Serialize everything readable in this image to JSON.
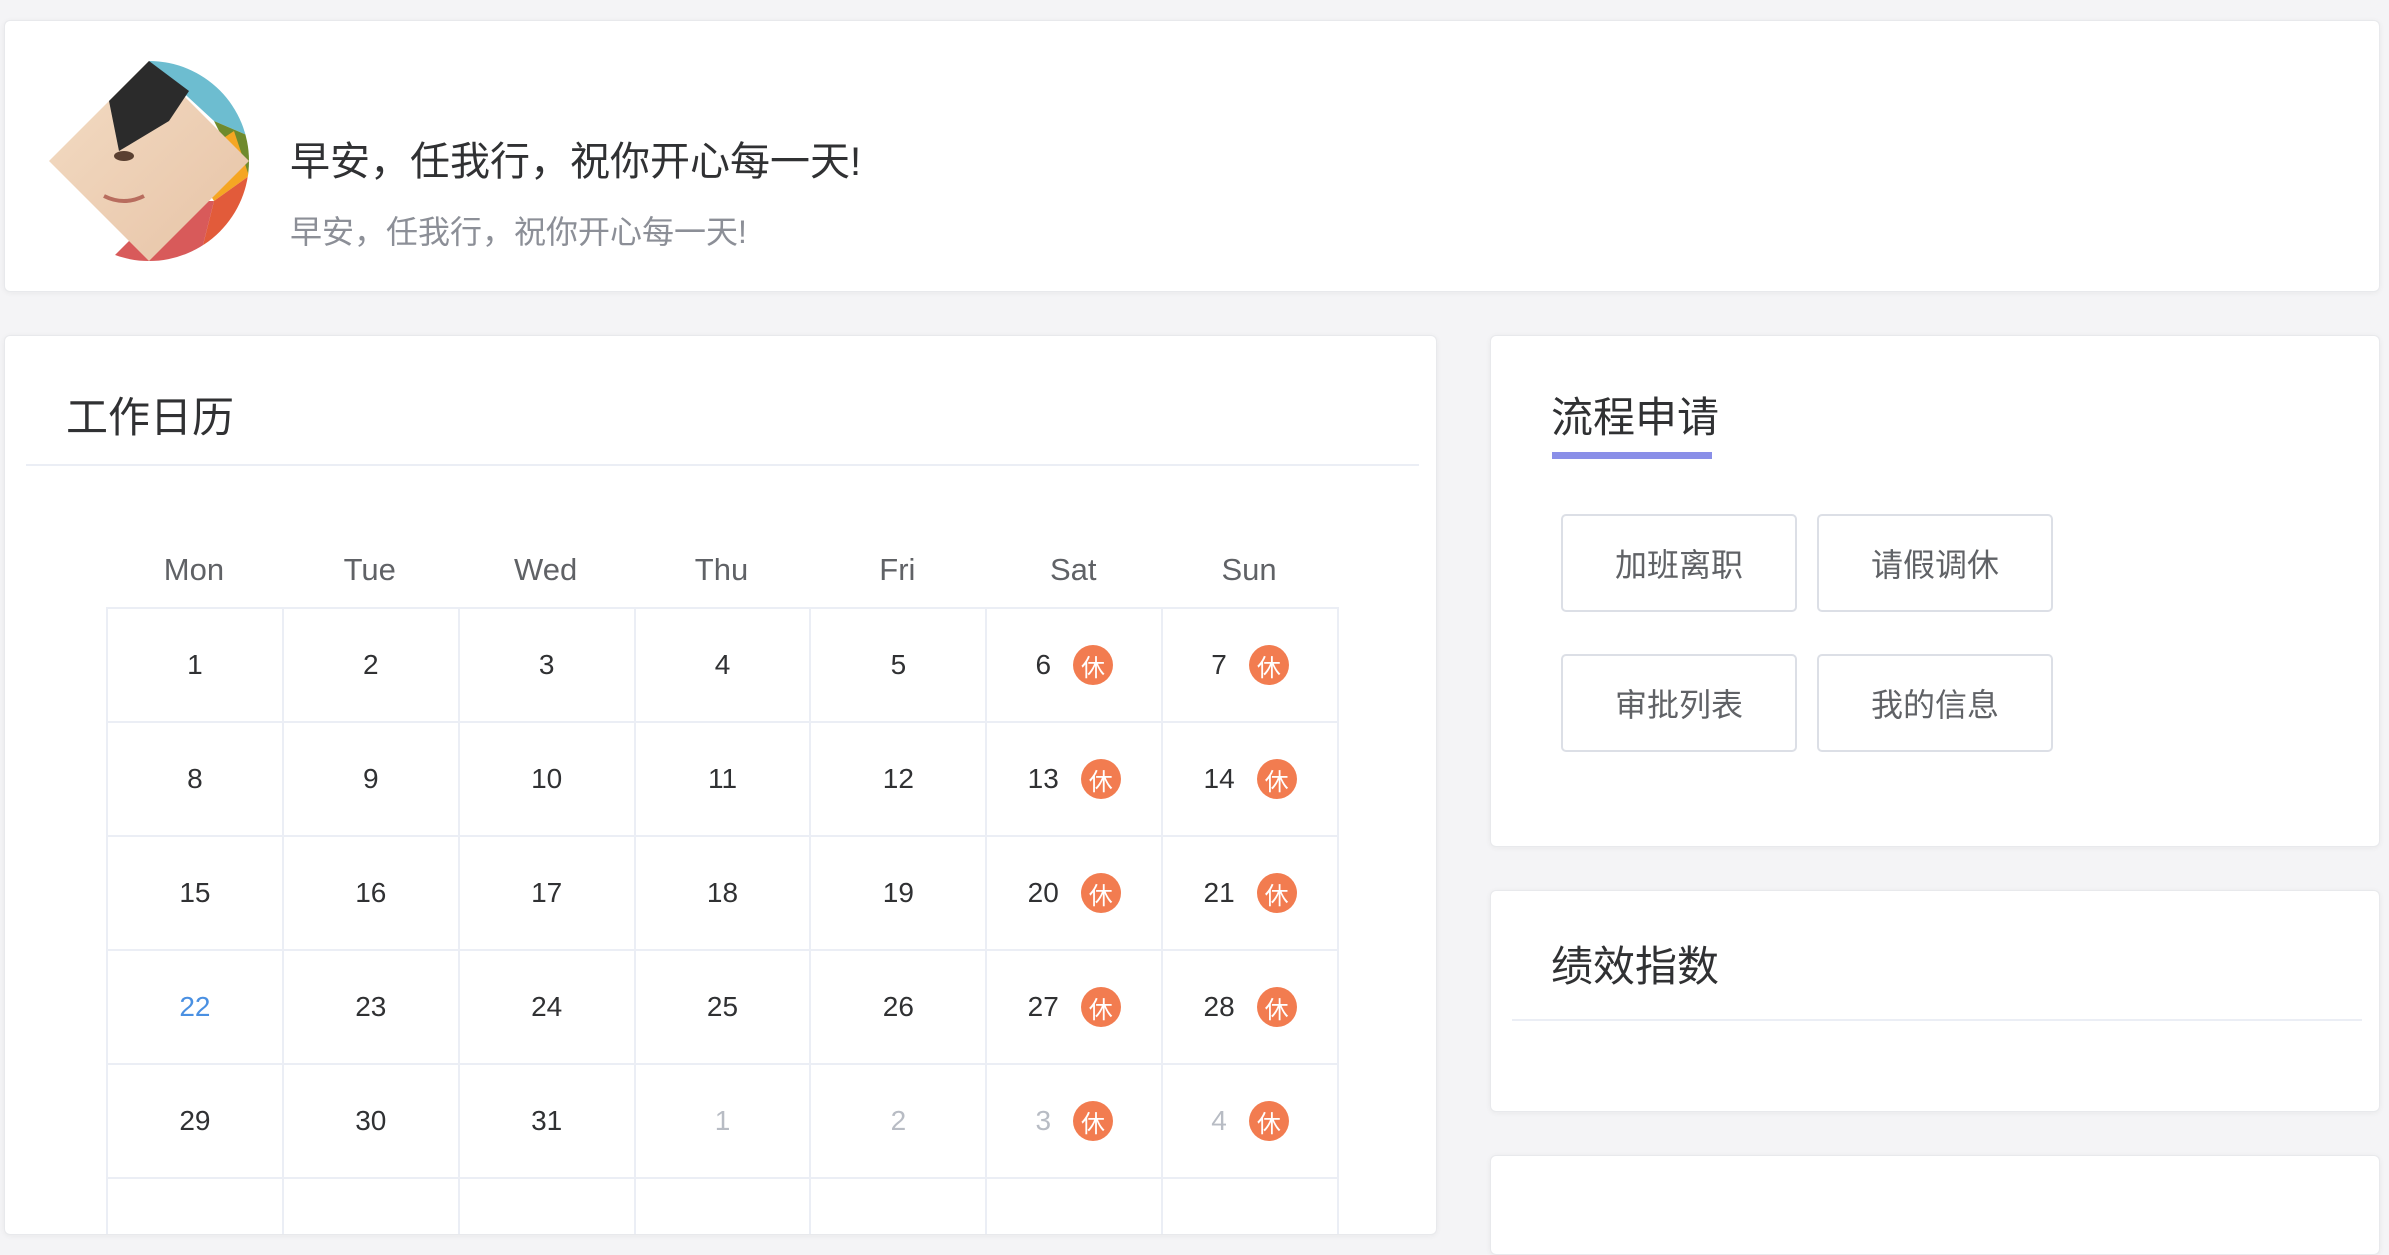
{
  "greeting": {
    "title": "早安，任我行，祝你开心每一天!",
    "subtitle": "早安，任我行，祝你开心每一天!"
  },
  "calendar": {
    "title": "工作日历",
    "weekdays": [
      "Mon",
      "Tue",
      "Wed",
      "Thu",
      "Fri",
      "Sat",
      "Sun"
    ],
    "rest_label": "休",
    "weeks": [
      [
        {
          "d": "1"
        },
        {
          "d": "2"
        },
        {
          "d": "3"
        },
        {
          "d": "4"
        },
        {
          "d": "5"
        },
        {
          "d": "6",
          "rest": true
        },
        {
          "d": "7",
          "rest": true
        }
      ],
      [
        {
          "d": "8"
        },
        {
          "d": "9"
        },
        {
          "d": "10"
        },
        {
          "d": "11"
        },
        {
          "d": "12"
        },
        {
          "d": "13",
          "rest": true
        },
        {
          "d": "14",
          "rest": true
        }
      ],
      [
        {
          "d": "15"
        },
        {
          "d": "16"
        },
        {
          "d": "17"
        },
        {
          "d": "18"
        },
        {
          "d": "19"
        },
        {
          "d": "20",
          "rest": true
        },
        {
          "d": "21",
          "rest": true
        }
      ],
      [
        {
          "d": "22",
          "today": true
        },
        {
          "d": "23"
        },
        {
          "d": "24"
        },
        {
          "d": "25"
        },
        {
          "d": "26"
        },
        {
          "d": "27",
          "rest": true
        },
        {
          "d": "28",
          "rest": true
        }
      ],
      [
        {
          "d": "29"
        },
        {
          "d": "30"
        },
        {
          "d": "31"
        },
        {
          "d": "1",
          "other": true
        },
        {
          "d": "2",
          "other": true
        },
        {
          "d": "3",
          "other": true,
          "rest": true
        },
        {
          "d": "4",
          "other": true,
          "rest": true
        }
      ],
      [
        {
          "d": ""
        },
        {
          "d": ""
        },
        {
          "d": ""
        },
        {
          "d": ""
        },
        {
          "d": ""
        },
        {
          "d": ""
        },
        {
          "d": ""
        }
      ]
    ]
  },
  "process": {
    "title": "流程申请",
    "buttons": [
      "加班离职",
      "请假调休",
      "审批列表",
      "我的信息"
    ]
  },
  "performance": {
    "title": "绩效指数"
  },
  "colors": {
    "rest_badge": "#f27c50",
    "today": "#4a90e2",
    "tab_underline": "#8a8fe8"
  }
}
